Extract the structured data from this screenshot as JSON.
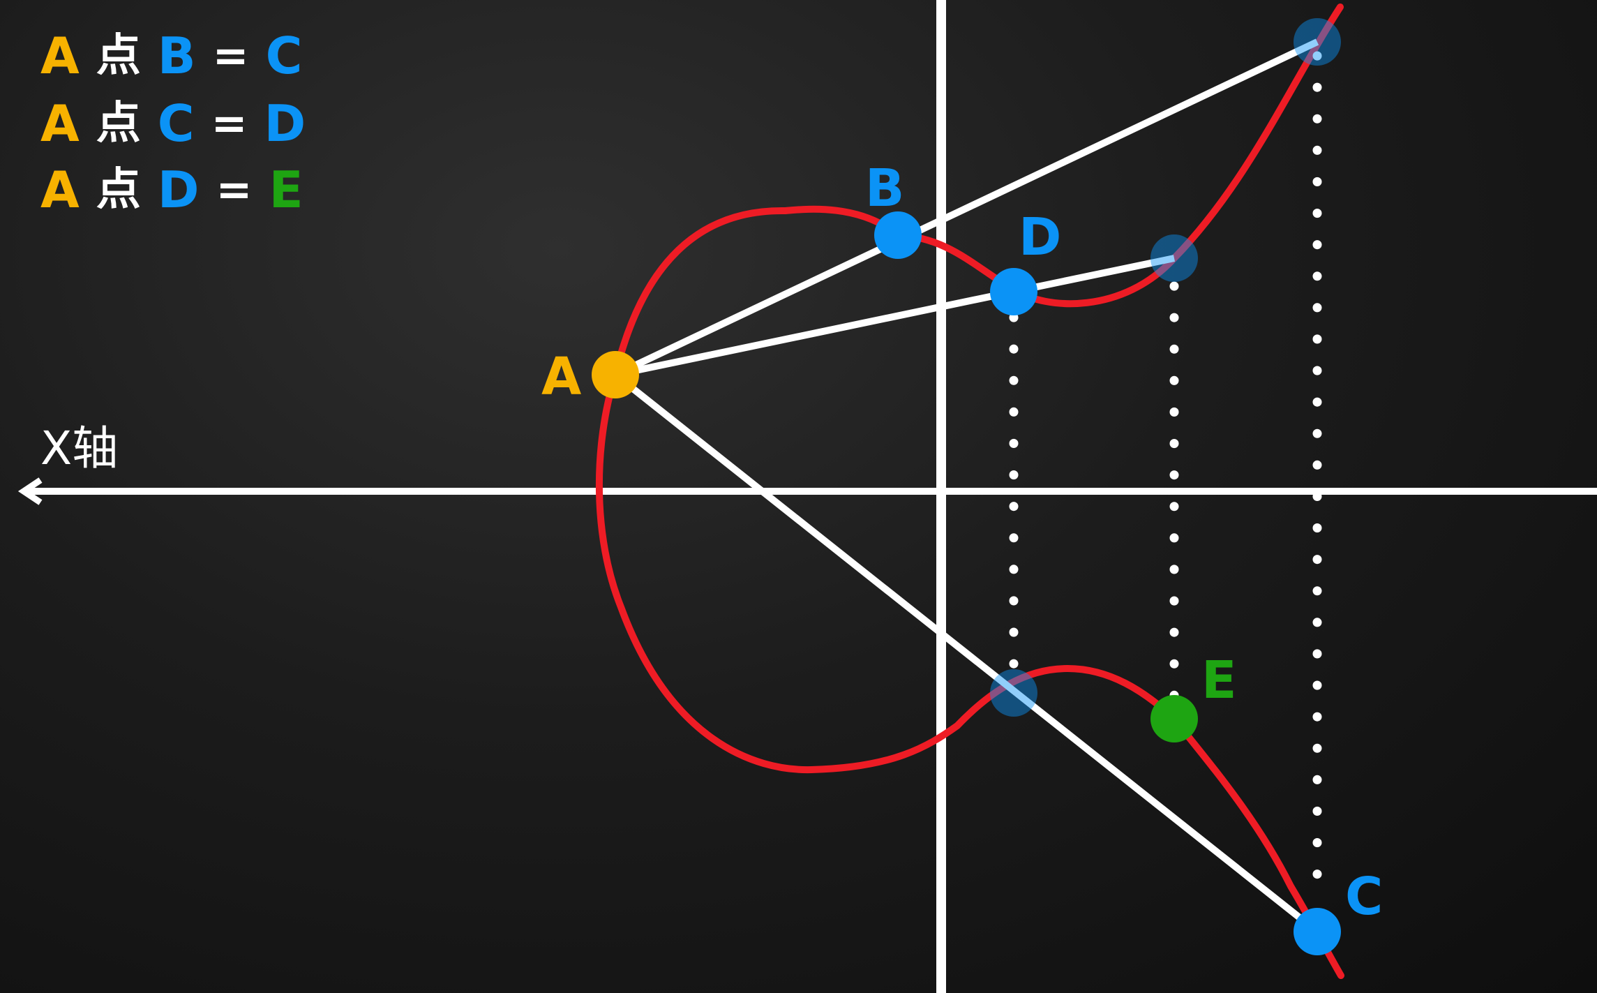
{
  "equations": [
    {
      "a": "A",
      "op": "点",
      "b": "B",
      "eq": "=",
      "result": "C",
      "result_color": "blue"
    },
    {
      "a": "A",
      "op": "点",
      "b": "C",
      "eq": "=",
      "result": "D",
      "result_color": "blue"
    },
    {
      "a": "A",
      "op": "点",
      "b": "D",
      "eq": "=",
      "result": "E",
      "result_color": "green"
    }
  ],
  "axis": {
    "x_label": "X轴"
  },
  "points": {
    "A": "A",
    "B": "B",
    "C": "C",
    "D": "D",
    "E": "E"
  },
  "colors": {
    "curve": "#ee1c25",
    "point_a": "#f7b200",
    "point_blue": "#0b93f6",
    "point_green": "#1ea512",
    "line": "#ffffff",
    "background": "#141414"
  }
}
